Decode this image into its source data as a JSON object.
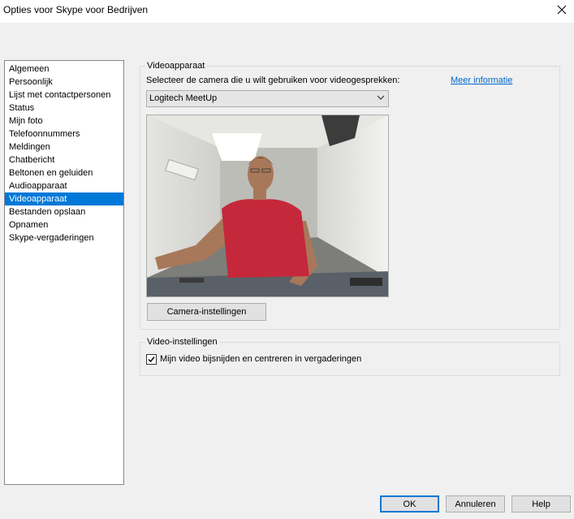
{
  "window": {
    "title": "Opties voor Skype voor Bedrijven"
  },
  "icons": {
    "close": "close-icon",
    "dropdown": "chevron-down-icon",
    "check": "checkmark-icon"
  },
  "sidebar": {
    "items": [
      {
        "label": "Algemeen"
      },
      {
        "label": "Persoonlijk"
      },
      {
        "label": "Lijst met contactpersonen"
      },
      {
        "label": "Status"
      },
      {
        "label": "Mijn foto"
      },
      {
        "label": "Telefoonnummers"
      },
      {
        "label": "Meldingen"
      },
      {
        "label": "Chatbericht"
      },
      {
        "label": "Beltonen en geluiden"
      },
      {
        "label": "Audioapparaat"
      },
      {
        "label": "Videoapparaat",
        "selected": true
      },
      {
        "label": "Bestanden opslaan"
      },
      {
        "label": "Opnamen"
      },
      {
        "label": "Skype-vergaderingen"
      }
    ],
    "accent_color": "#0078d7"
  },
  "video_device": {
    "group_title": "Videoapparaat",
    "prompt": "Selecteer de camera die u wilt gebruiken voor videogesprekken:",
    "more_info_link": "Meer informatie",
    "camera_select": {
      "value": "Logitech MeetUp"
    },
    "camera_settings_button": "Camera-instellingen"
  },
  "video_settings": {
    "group_title": "Video-instellingen",
    "crop_center": {
      "label": "Mijn video bijsnijden en centreren in vergaderingen",
      "checked": true
    }
  },
  "footer": {
    "ok": "OK",
    "cancel": "Annuleren",
    "help": "Help"
  }
}
